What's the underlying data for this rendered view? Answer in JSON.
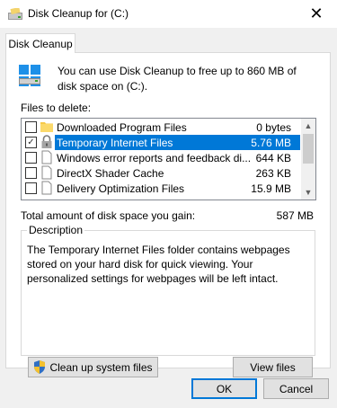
{
  "window": {
    "title": "Disk Cleanup for  (C:)",
    "close_glyph": "✕",
    "icon": "disk-cleanup-icon"
  },
  "tabs": [
    {
      "label": "Disk Cleanup",
      "active": true
    }
  ],
  "intro": {
    "icon": "drive-icon",
    "text": "You can use Disk Cleanup to free up to 860 MB of disk space on  (C:)."
  },
  "files": {
    "label": "Files to delete:",
    "items": [
      {
        "name": "Downloaded Program Files",
        "size": "0 bytes",
        "checked": false,
        "icon": "folder-icon",
        "selected": false
      },
      {
        "name": "Temporary Internet Files",
        "size": "5.76 MB",
        "checked": true,
        "icon": "lock-icon",
        "selected": true
      },
      {
        "name": "Windows error reports and feedback di...",
        "size": "644 KB",
        "checked": false,
        "icon": "file-icon",
        "selected": false
      },
      {
        "name": "DirectX Shader Cache",
        "size": "263 KB",
        "checked": false,
        "icon": "file-icon",
        "selected": false
      },
      {
        "name": "Delivery Optimization Files",
        "size": "15.9 MB",
        "checked": false,
        "icon": "file-icon",
        "selected": false
      }
    ]
  },
  "total": {
    "label": "Total amount of disk space you gain:",
    "value": "587 MB"
  },
  "description": {
    "legend": "Description",
    "text": "The Temporary Internet Files folder contains webpages stored on your hard disk for quick viewing. Your personalized settings for webpages will be left intact."
  },
  "buttons": {
    "cleanup_system": "Clean up system files",
    "view_files": "View files",
    "ok": "OK",
    "cancel": "Cancel"
  },
  "colors": {
    "selection": "#0078d7",
    "accent": "#0078d7"
  }
}
